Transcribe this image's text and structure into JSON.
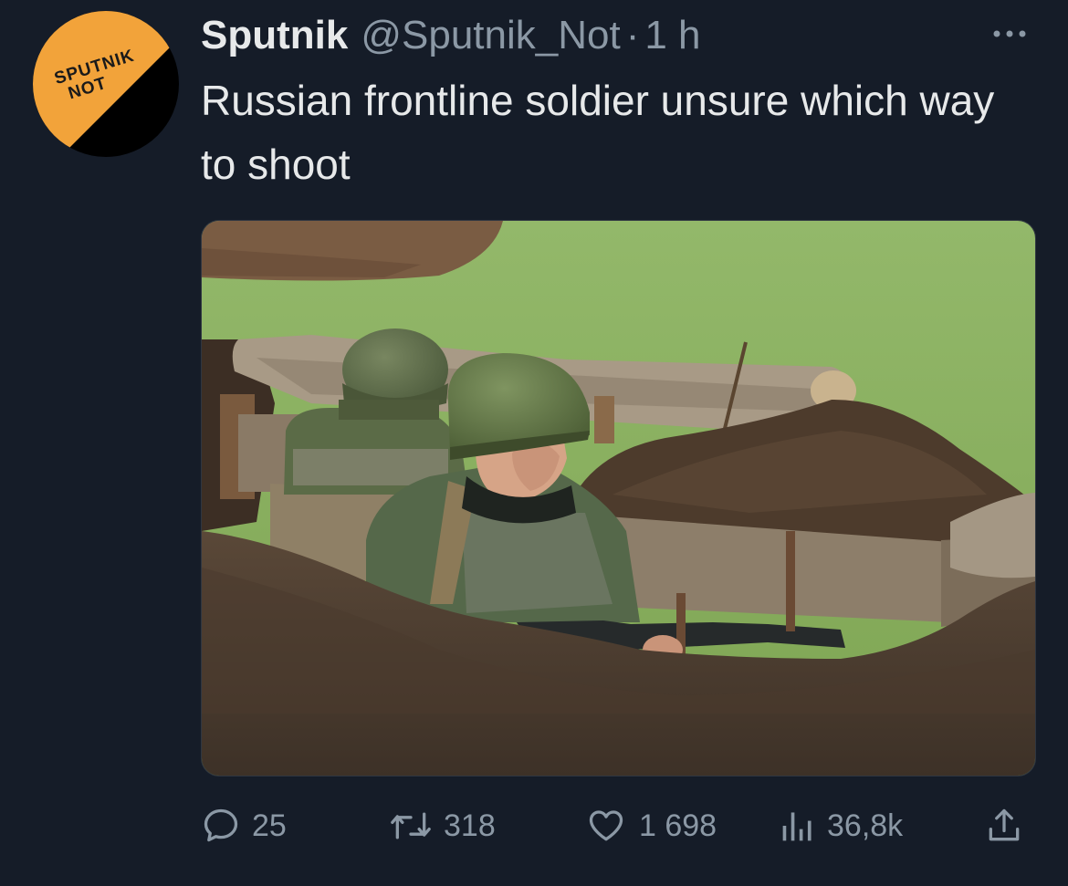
{
  "tweet": {
    "author": {
      "display_name": "Sputnik",
      "handle": "@Sputnik_Not",
      "avatar_logo_text": [
        "SPUTNIK",
        "NOT"
      ],
      "avatar_colors": {
        "orange": "#f2a33a",
        "black": "#000000"
      }
    },
    "separator": "·",
    "time": "1 h",
    "more_icon": "more-horizontal-icon",
    "text": "Russian frontline soldier unsure which way to shoot",
    "media": {
      "type": "photo",
      "icon": "photo"
    },
    "actions": [
      {
        "name": "reply",
        "icon": "speech-bubble-icon",
        "count": "25"
      },
      {
        "name": "retweet",
        "icon": "retweet-arrows-icon",
        "count": "318"
      },
      {
        "name": "like",
        "icon": "heart-icon",
        "count": "1 698"
      },
      {
        "name": "views",
        "icon": "bar-chart-icon",
        "count": "36,8k"
      },
      {
        "name": "share",
        "icon": "share-upload-icon",
        "count": ""
      }
    ]
  },
  "colors": {
    "background": "#151c28",
    "text_primary": "#e7e9ea",
    "text_secondary": "#8b98a5"
  }
}
